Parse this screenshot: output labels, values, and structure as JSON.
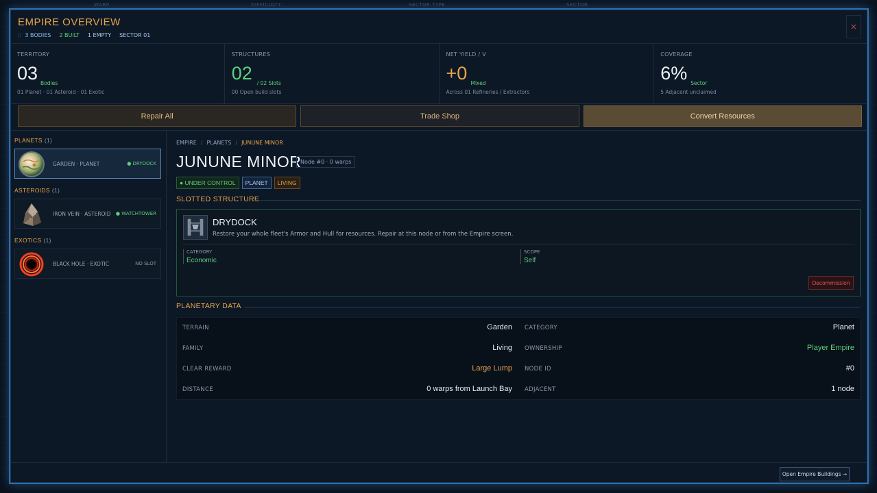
{
  "background_header": [
    "WARP",
    "DIFFICULTY",
    "SECTOR TYPE",
    "SECTOR"
  ],
  "header": {
    "title": "EMPIRE OVERVIEW",
    "bodies": "3 BODIES",
    "built": "2 BUILT",
    "empty": "1 EMPTY",
    "sector": "SECTOR 01",
    "close": "×"
  },
  "stats": [
    {
      "label": "TERRITORY",
      "value": "03",
      "unit": "Bodies",
      "note": "01 Planet · 01 Asteroid · 01 Exotic"
    },
    {
      "label": "STRUCTURES",
      "value": "02",
      "unit": "/ 02 Slots",
      "note": "00 Open build slots"
    },
    {
      "label": "NET YIELD / V",
      "value": "+0",
      "unit": "Mixed",
      "note": "Across 01 Refineries / Extractors"
    },
    {
      "label": "COVERAGE",
      "value": "6%",
      "unit": "Sector",
      "note": "5 Adjacent unclaimed"
    }
  ],
  "actions": {
    "repair": "Repair All",
    "trade": "Trade Shop",
    "convert": "Convert Resources"
  },
  "sidebar": {
    "planets": {
      "label": "PLANETS",
      "count": "(1)",
      "name": "GARDEN · PLANET",
      "tag": "● DRYDOCK"
    },
    "asteroids": {
      "label": "ASTEROIDS",
      "count": "(1)",
      "name": "IRON VEIN · ASTEROID",
      "tag": "● WATCHTOWER"
    },
    "exotics": {
      "label": "EXOTICS",
      "count": "(1)",
      "name": "BLACK HOLE · EXOTIC",
      "tag": "NO SLOT"
    }
  },
  "breadcrumb": {
    "a": "EMPIRE",
    "b": "PLANETS",
    "c": "JUNUNE MINOR",
    "sep": "/"
  },
  "planet": {
    "name": "JUNUNE MINOR",
    "node": "Node #0 · 0 warps",
    "tags": [
      "● UNDER CONTROL",
      "PLANET",
      "LIVING"
    ]
  },
  "structure": {
    "section": "SLOTTED STRUCTURE",
    "name": "DRYDOCK",
    "desc": "Restore your whole fleet's Armor and Hull for resources. Repair at this node or from the Empire screen.",
    "category_label": "CATEGORY",
    "category": "Economic",
    "scope_label": "SCOPE",
    "scope": "Self",
    "decommission": "Decommission"
  },
  "planetary": {
    "section": "PLANETARY DATA",
    "rows": [
      {
        "k1": "TERRAIN",
        "v1": "Garden",
        "k2": "CATEGORY",
        "v2": "Planet"
      },
      {
        "k1": "FAMILY",
        "v1": "Living",
        "k2": "OWNERSHIP",
        "v2": "Player Empire"
      },
      {
        "k1": "CLEAR REWARD",
        "v1": "Large Lump",
        "k2": "NODE ID",
        "v2": "#0"
      },
      {
        "k1": "DISTANCE",
        "v1": "0 warps from Launch Bay",
        "k2": "ADJACENT",
        "v2": "1 node"
      }
    ]
  },
  "footer": {
    "open_buildings": "Open Empire Buildings →"
  },
  "colors": {
    "accent": "#e8a54a",
    "green": "#5ed07a",
    "border": "#2f6ea8",
    "danger": "#e05a50"
  }
}
